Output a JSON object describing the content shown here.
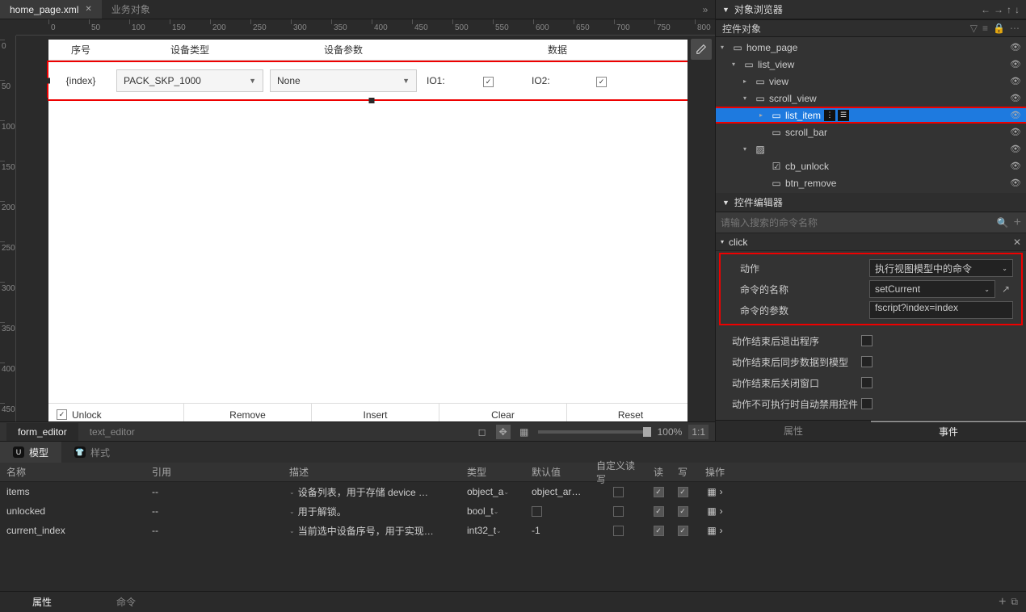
{
  "tabs": {
    "file": "home_page.xml",
    "second": "业务对象"
  },
  "ruler_h": [
    0,
    50,
    100,
    150,
    200,
    250,
    300,
    350,
    400,
    450,
    500,
    550,
    600,
    650,
    700,
    750,
    800
  ],
  "ruler_v": [
    0,
    50,
    100,
    150,
    200,
    250,
    300,
    350,
    400,
    450
  ],
  "form": {
    "headers": {
      "index": "序号",
      "type": "设备类型",
      "param": "设备参数",
      "data": "数据"
    },
    "row": {
      "index": "{index}",
      "combo1": "PACK_SKP_1000",
      "combo2": "None",
      "io1": "IO1:",
      "io2": "IO2:"
    },
    "footer": {
      "unlock": "Unlock",
      "remove": "Remove",
      "insert": "Insert",
      "clear": "Clear",
      "reset": "Reset"
    }
  },
  "editor_tabs": {
    "form": "form_editor",
    "text": "text_editor"
  },
  "zoom": {
    "pct": "100%",
    "ratio": "1:1"
  },
  "browser": {
    "title": "对象浏览器",
    "subtitle": "控件对象",
    "tree": {
      "home_page": "home_page",
      "list_view": "list_view",
      "view": "view",
      "scroll_view": "scroll_view",
      "list_item": "list_item",
      "scroll_bar": "scroll_bar",
      "cb_unlock": "cb_unlock",
      "btn_remove": "btn_remove"
    }
  },
  "propeditor": {
    "title": "控件编辑器",
    "search_ph": "请输入搜索的命令名称",
    "group": "click",
    "rows": {
      "action": {
        "label": "动作",
        "value": "执行视图模型中的命令"
      },
      "cmd_name": {
        "label": "命令的名称",
        "value": "setCurrent"
      },
      "cmd_param": {
        "label": "命令的参数",
        "value": "fscript?index=index"
      },
      "exit": {
        "label": "动作结束后退出程序"
      },
      "sync": {
        "label": "动作结束后同步数据到模型"
      },
      "close": {
        "label": "动作结束后关闭窗口"
      },
      "disable": {
        "label": "动作不可执行时自动禁用控件"
      }
    }
  },
  "right_tabs": {
    "prop": "属性",
    "event": "事件"
  },
  "model": {
    "tab1": "模型",
    "tab2": "样式",
    "cols": {
      "name": "名称",
      "ref": "引用",
      "desc": "描述",
      "type": "类型",
      "def": "默认值",
      "cust": "自定义读写",
      "r": "读",
      "w": "写",
      "op": "操作"
    },
    "rows": [
      {
        "name": "items",
        "ref": "--",
        "desc": "设备列表，用于存储 device …",
        "type": "object_a",
        "def": "object_ar…"
      },
      {
        "name": "unlocked",
        "ref": "--",
        "desc": "用于解锁。",
        "type": "bool_t",
        "def": ""
      },
      {
        "name": "current_index",
        "ref": "--",
        "desc": "当前选中设备序号，用于实现…",
        "type": "int32_t",
        "def": "-1"
      }
    ]
  },
  "bottom_tabs": {
    "prop": "属性",
    "cmd": "命令"
  }
}
